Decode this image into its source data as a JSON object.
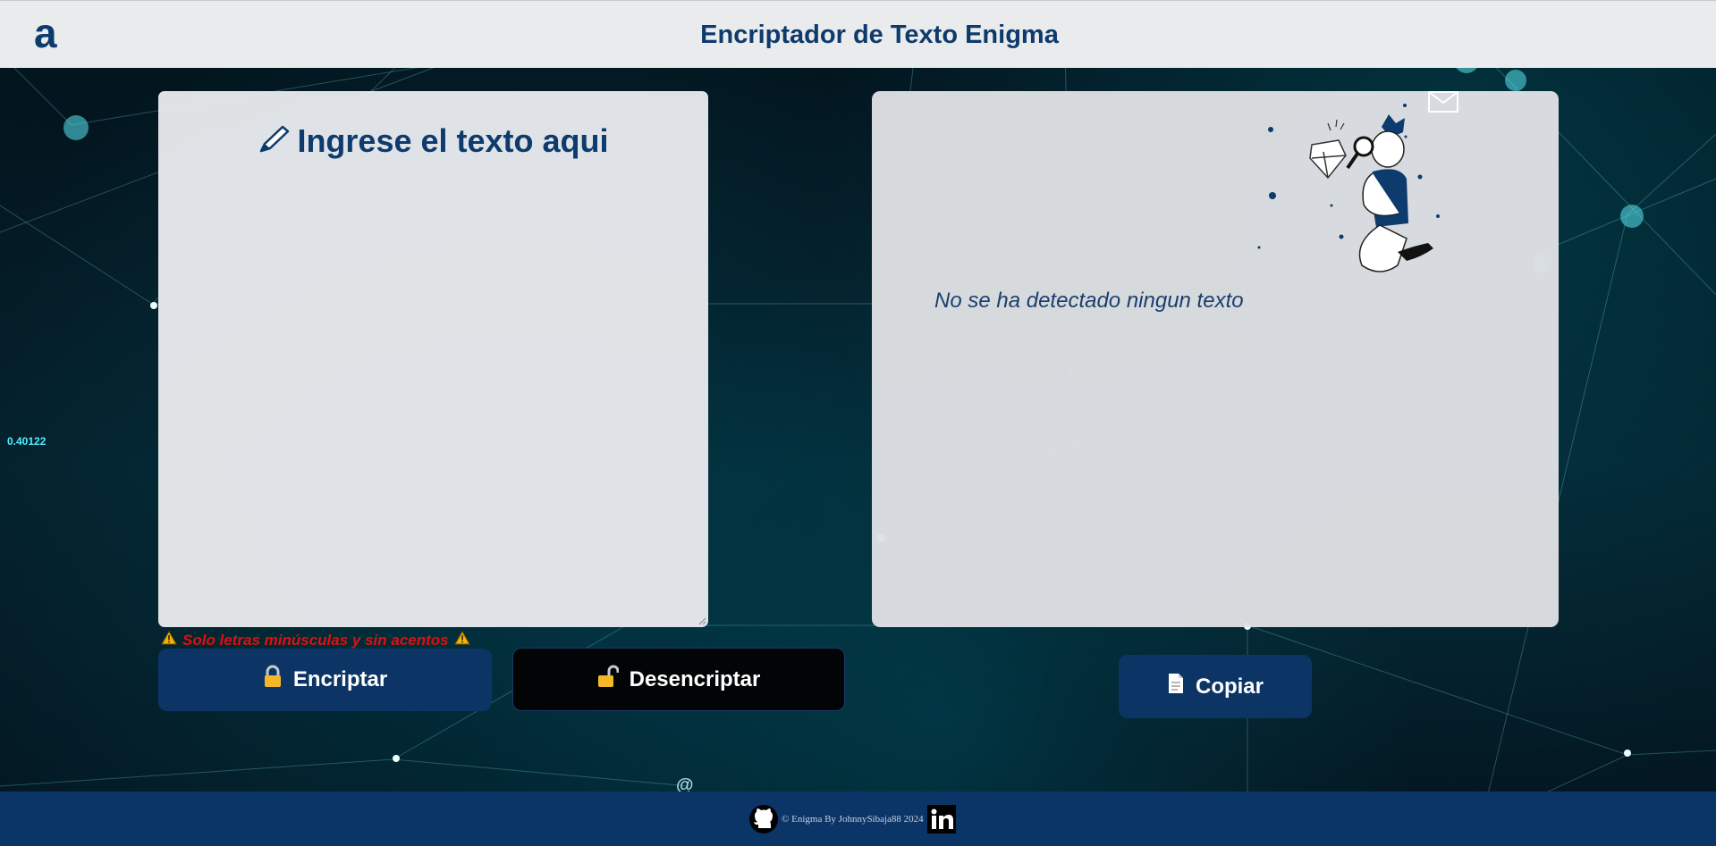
{
  "header": {
    "logo_text": "a",
    "title": "Encriptador de Texto Enigma"
  },
  "input_panel": {
    "heading": "Ingrese el texto aqui",
    "pen_icon": "pencil-icon",
    "textarea_value": "",
    "warning_text": "Solo letras minúsculas y sin acentos",
    "warning_icon": "warning-icon"
  },
  "buttons": {
    "encrypt_label": "Encriptar",
    "encrypt_icon": "lock-icon",
    "decrypt_label": "Desencriptar",
    "decrypt_icon": "unlock-icon",
    "copy_label": "Copiar",
    "copy_icon": "document-icon"
  },
  "output_panel": {
    "empty_message": "No se ha detectado ningun texto",
    "illustration": "searching-person-illustration"
  },
  "footer": {
    "text": "© Enigma By JohnnySibaja88 2024",
    "github_icon": "github-icon",
    "linkedin_icon": "linkedin-icon"
  },
  "background": {
    "decorations": [
      "0.40122",
      "0.40122",
      "0.40122",
      "@",
      "@",
      "@"
    ]
  },
  "colors": {
    "primary": "#0c3566",
    "title": "#0f3a6c",
    "warning": "#e10f0f",
    "header_bg": "#e9ebed",
    "accent_cyan": "#4ff0ff"
  }
}
